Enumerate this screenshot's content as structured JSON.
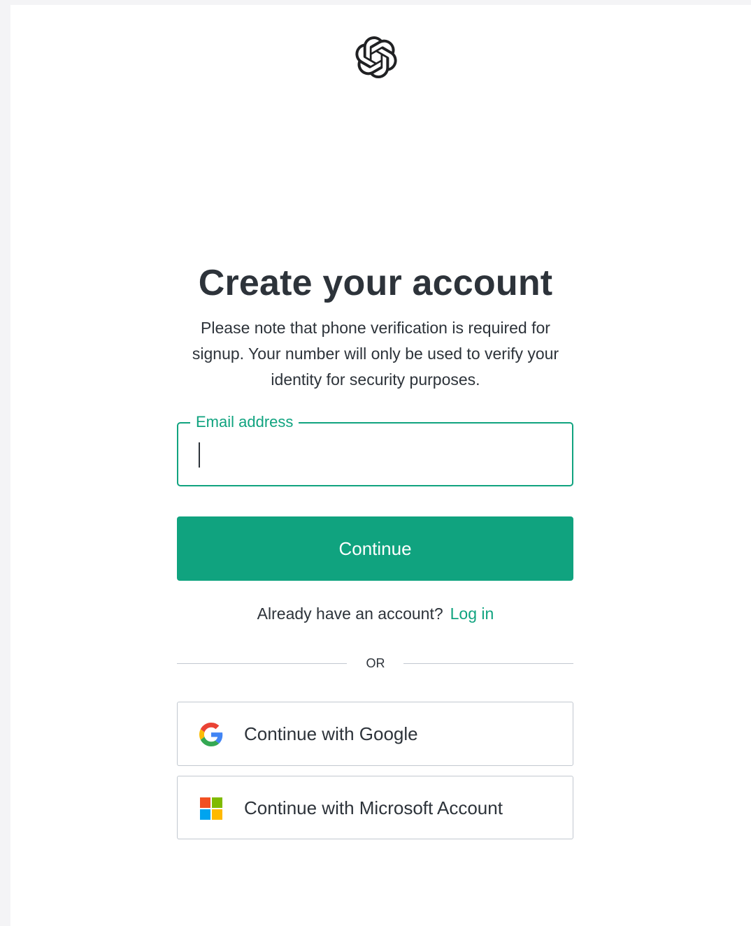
{
  "brand": {
    "logo_icon": "openai-logo-icon"
  },
  "header": {
    "title": "Create your account",
    "subtitle": "Please note that phone verification is required for signup. Your number will only be used to verify your identity for security purposes."
  },
  "form": {
    "email_label": "Email address",
    "email_value": "",
    "continue_label": "Continue"
  },
  "login": {
    "prompt": "Already have an account?",
    "link_label": "Log in"
  },
  "divider": {
    "text": "OR"
  },
  "social": {
    "google_label": "Continue with Google",
    "google_icon": "google-icon",
    "microsoft_label": "Continue with Microsoft Account",
    "microsoft_icon": "microsoft-icon"
  },
  "colors": {
    "accent": "#10a37f",
    "text": "#2d333a",
    "border": "#c2c8d0",
    "background": "#ffffff",
    "page_background": "#f4f4f6"
  }
}
